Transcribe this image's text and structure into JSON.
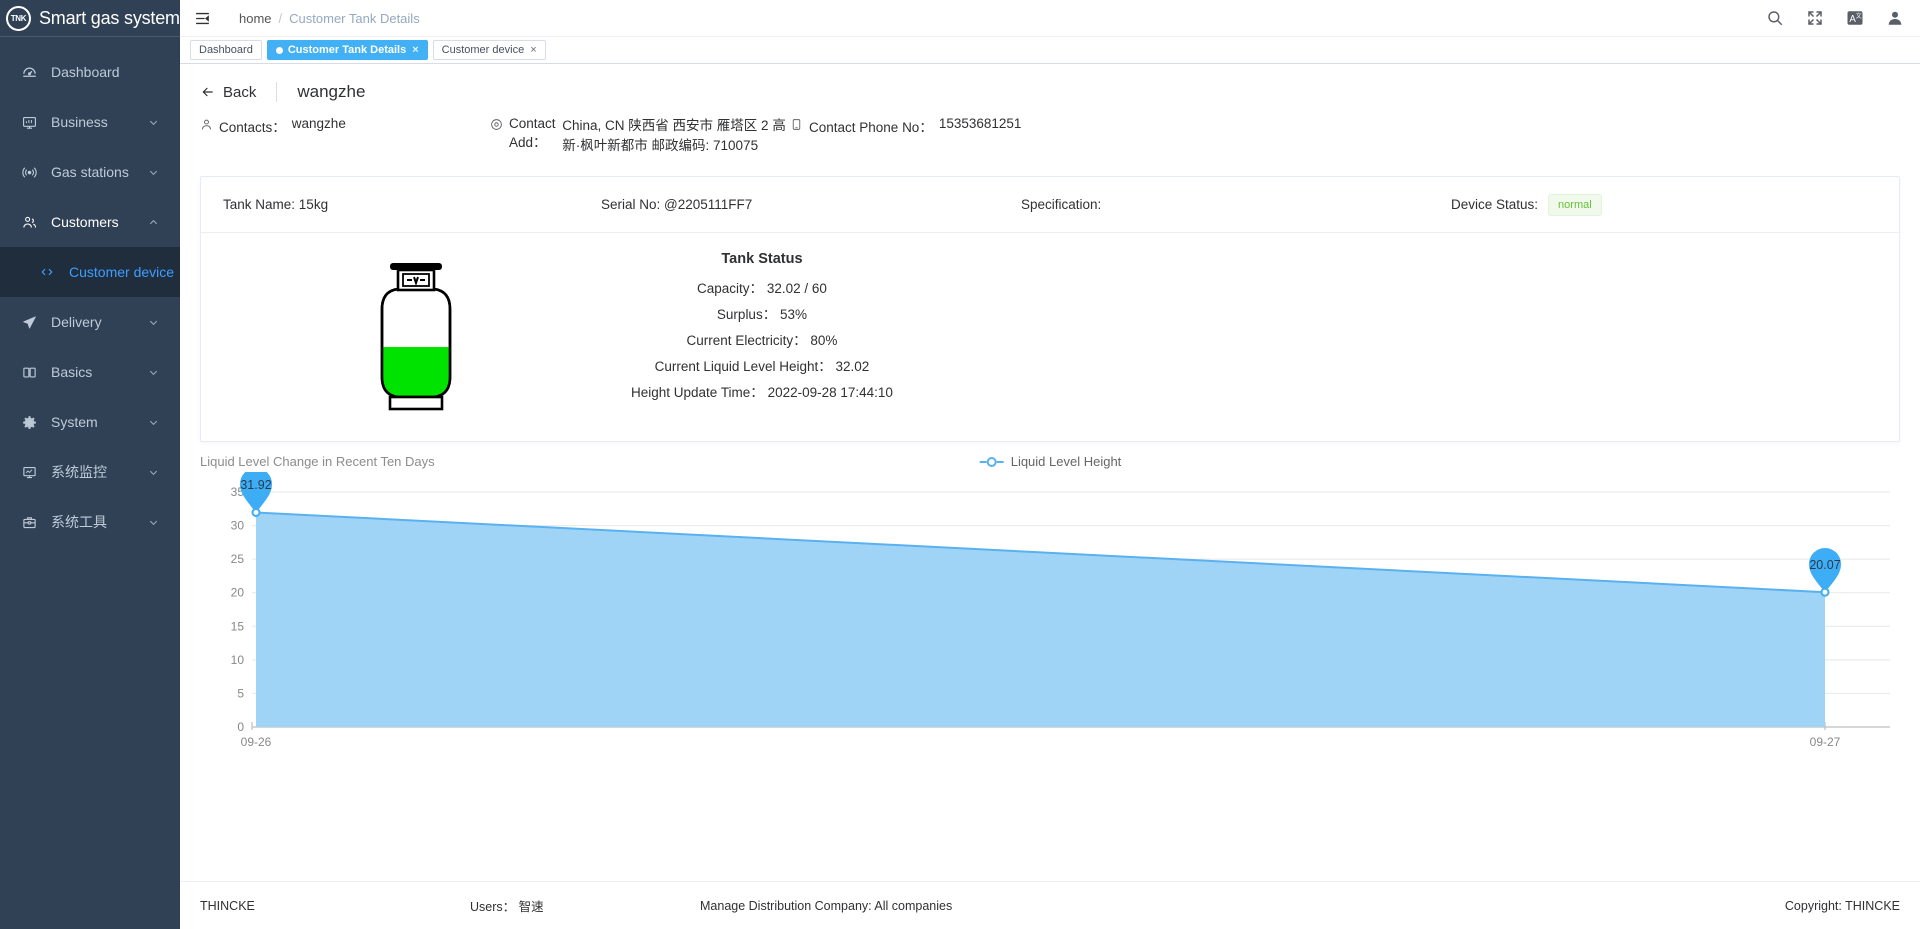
{
  "brand": {
    "logo_text": "TNK",
    "title": "Smart gas system"
  },
  "sidebar": {
    "items": [
      {
        "label": "Dashboard",
        "icon": "dashboard-icon",
        "arrow": ""
      },
      {
        "label": "Business",
        "icon": "monitor-icon",
        "arrow": "chevron-down-icon"
      },
      {
        "label": "Gas stations",
        "icon": "broadcast-icon",
        "arrow": "chevron-down-icon"
      },
      {
        "label": "Customers",
        "icon": "people-icon",
        "arrow": "chevron-up-icon",
        "active": true
      },
      {
        "label": "Delivery",
        "icon": "send-icon",
        "arrow": "chevron-down-icon"
      },
      {
        "label": "Basics",
        "icon": "book-icon",
        "arrow": "chevron-down-icon"
      },
      {
        "label": "System",
        "icon": "gear-icon",
        "arrow": "chevron-down-icon"
      },
      {
        "label": "系统监控",
        "icon": "monitor-chart-icon",
        "arrow": "chevron-down-icon"
      },
      {
        "label": "系统工具",
        "icon": "toolbox-icon",
        "arrow": "chevron-down-icon"
      }
    ],
    "submenu": {
      "label": "Customer device",
      "icon": "code-icon"
    }
  },
  "navbar": {
    "hamburger": "hamburger-icon",
    "breadcrumb": {
      "home": "home",
      "separator": "/",
      "current": "Customer Tank Details"
    },
    "icons": [
      "search-icon",
      "fullscreen-icon",
      "translate-icon",
      "user-icon"
    ]
  },
  "tabs": [
    {
      "label": "Dashboard",
      "active": false,
      "closable": false
    },
    {
      "label": "Customer Tank Details",
      "active": true,
      "closable": true,
      "close": "×"
    },
    {
      "label": "Customer device",
      "active": false,
      "closable": true,
      "close": "×"
    }
  ],
  "page": {
    "back_label": "Back",
    "back_icon": "arrow-left-icon",
    "customer_name": "wangzhe"
  },
  "contact": {
    "contacts_label": "Contacts：",
    "contacts_value": "wangzhe",
    "contacts_icon": "person-icon",
    "address_label": "Contact Add：",
    "address_value": "China, CN 陕西省 西安市 雁塔区 2 高新·枫叶新都市 邮政编码: 710075",
    "address_icon": "location-icon",
    "phone_label": "Contact Phone No：",
    "phone_value": "15353681251",
    "phone_icon": "phone-icon"
  },
  "tank_card": {
    "tank_name_label": "Tank Name:",
    "tank_name_value": "15kg",
    "serial_label": "Serial No:",
    "serial_value": "@2205111FF7",
    "specification_label": "Specification:",
    "specification_value": "",
    "device_status_label": "Device Status:",
    "device_status_value": "normal",
    "status_color": "#67c23a",
    "tank_fill_color": "#00e300",
    "tank_fill_percent": 53
  },
  "tank_status": {
    "title": "Tank Status",
    "lines": [
      {
        "label": "Capacity：",
        "value": "32.02 / 60"
      },
      {
        "label": "Surplus：",
        "value": "53%"
      },
      {
        "label": "Current Electricity：",
        "value": "80%"
      },
      {
        "label": "Current Liquid Level Height：",
        "value": "32.02"
      },
      {
        "label": "Height Update Time：",
        "value": "2022-09-28 17:44:10"
      }
    ]
  },
  "chart_data": {
    "type": "area",
    "title": "Liquid Level Change in Recent Ten Days",
    "legend": [
      "Liquid Level Height"
    ],
    "legend_position": "top-center",
    "legend_color": "#5ab1ef",
    "categories": [
      "09-26",
      "09-27"
    ],
    "x": [
      "09-26",
      "09-27"
    ],
    "series": [
      {
        "name": "Liquid Level Height",
        "values": [
          31.92,
          20.07
        ]
      }
    ],
    "point_labels": [
      "31.92",
      "20.07"
    ],
    "yticks": [
      0,
      5,
      10,
      15,
      20,
      25,
      30,
      35
    ],
    "ytick_labels": [
      "0",
      "5",
      "10",
      "15",
      "20",
      "25",
      "30",
      "35"
    ],
    "ylim": [
      0,
      35
    ],
    "xlabel": "",
    "ylabel": "",
    "grid": true,
    "area_color": "#9fd4f7",
    "line_color": "#5ab1ef"
  },
  "footer": {
    "brand": "THINCKE",
    "users_label": "Users：",
    "users_value": "智速",
    "company_label": "Manage Distribution Company:",
    "company_value": "All companies",
    "copyright": "Copyright: THINCKE"
  }
}
